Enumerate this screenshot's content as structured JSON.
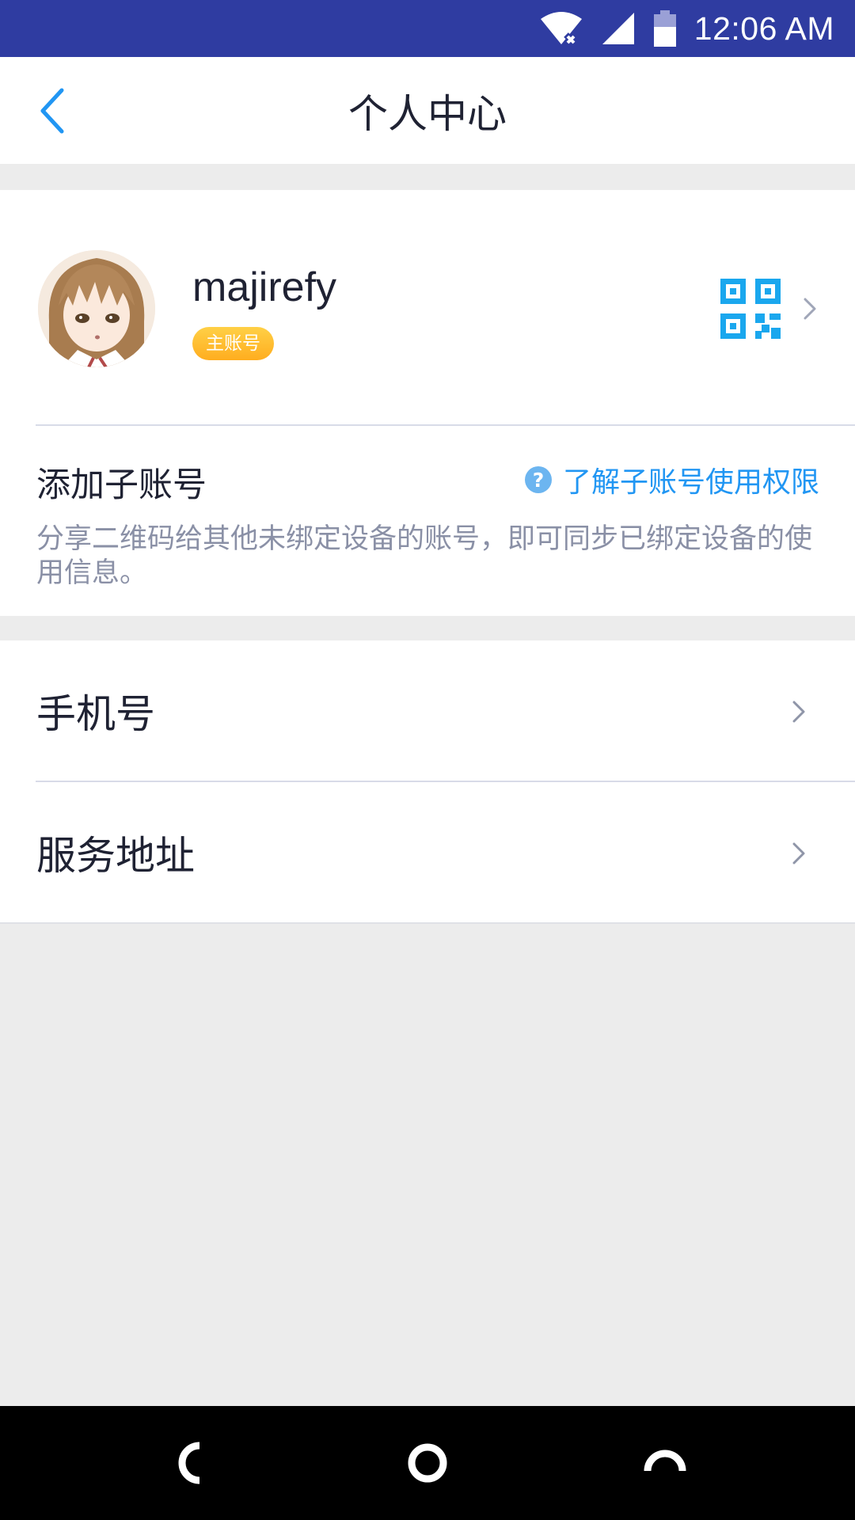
{
  "status_bar": {
    "time": "12:06 AM",
    "icons": [
      "wifi-no-internet-icon",
      "cellular-signal-icon",
      "battery-icon"
    ]
  },
  "header": {
    "title": "个人中心",
    "back_icon": "chevron-left-icon"
  },
  "profile": {
    "username": "majirefy",
    "badge": "主账号",
    "qr_icon": "qr-code-icon"
  },
  "sub_account": {
    "title": "添加子账号",
    "help_link": "了解子账号使用权限",
    "description": "分享二维码给其他未绑定设备的账号，即可同步已绑定设备的使用信息。"
  },
  "menu": {
    "items": [
      {
        "label": "手机号"
      },
      {
        "label": "服务地址"
      }
    ]
  },
  "colors": {
    "status_bar": "#2f3ca1",
    "accent": "#2196f3",
    "badge": "#ffad1f",
    "background": "#ececec"
  },
  "nav_bar": {
    "icons": [
      "back-nav-icon",
      "home-nav-icon",
      "recents-nav-icon"
    ]
  }
}
